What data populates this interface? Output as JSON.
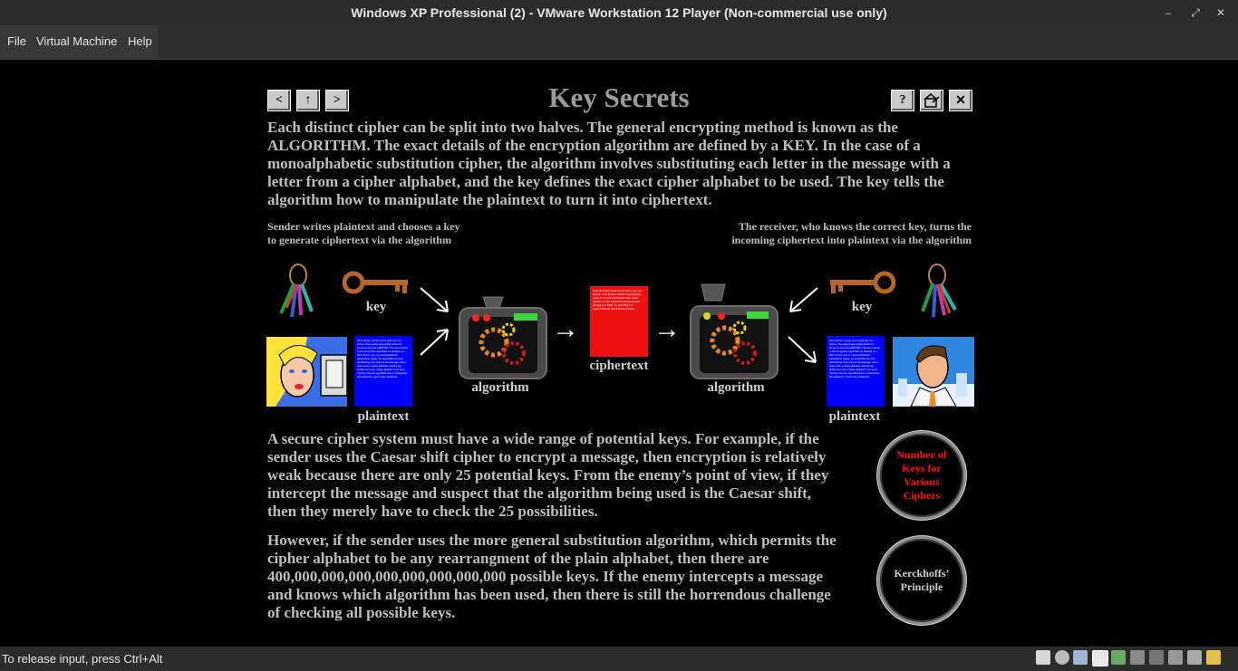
{
  "window": {
    "title": "Windows XP Professional (2) - VMware Workstation 12 Player (Non-commercial use only)",
    "controls": [
      "–",
      "⤢",
      "✕"
    ]
  },
  "menu": [
    "File",
    "Virtual Machine",
    "Help"
  ],
  "status": {
    "message": "To release input, press Ctrl+Alt"
  },
  "page": {
    "title": "Key Secrets",
    "nav": {
      "prev": "<",
      "up": "↑",
      "next": ">",
      "help": "?",
      "close": "✕"
    },
    "intro": "Each distinct cipher can be split into two halves. The general encrypting method is known as the ALGORITHM. The exact details of the encryption algorithm are defined by a KEY. In the case of a monoalphabetic substitution cipher, the algorithm involves substituting each letter in the message with a letter from a cipher alphabet, and the key defines the exact cipher alphabet to be used. The key tells the algorithm how to manipulate the plaintext to turn it into ciphertext.",
    "sender_caption": [
      "Sender writes plaintext and chooses a key",
      "to generate ciphertext via the algorithm"
    ],
    "receiver_caption": [
      "The receiver, who knows the correct key, turns the",
      "incoming ciphertext into plaintext via the algorithm"
    ],
    "diagram": {
      "key_left": "key",
      "key_right": "key",
      "plaintext_left": "plaintext",
      "plaintext_right": "plaintext",
      "algorithm_left": "algorithm",
      "algorithm_right": "algorithm",
      "ciphertext": "ciphertext",
      "arrow_right": "→",
      "plaintext_sample": "Each distinct cipher can be split into two halves. The general encrypting method is known as the ALGORITHM. The exact details of the encryption algorithm are defined by a KEY. In the case of a monoalphabetic substitution cipher, the algorithm involves substituting each letter in the message with a letter from a cipher alphabet, and the key defines the exact cipher alphabet to be used. The key tells the algorithm how to manipulate the plaintext to turn it into ciphertext.",
      "ciphertext_sample": "Eoeh dfvwlqfw flskhu fdq eh vsolw lqwr wzr kdoyhv. Wkh jhqhudo hqfubswlqj phwkrg lv nqrzq dv wkh DOJRULWKP. Wkh hadfw ghwdlov ri wkh hqfubswlrq dojrulwkp duh ghilqhg eb d NHB. Lq wkh fdvh ri d prqrdoskdehwlf vxevwlwxwlrq flskhu."
    },
    "para2": "A secure cipher system must have a wide range of potential keys. For example, if the sender uses the Caesar shift cipher to encrypt a message, then encryption is relatively weak because there are only 25 potential keys. From the enemy’s point of view, if they intercept the message and suspect that the algorithm being used is the Caesar shift, then they merely have to check the 25 possibilities.",
    "para3": "However, if the sender uses the more general substitution algorithm, which permits the cipher alphabet to be any rearrangment of the plain alphabet, then there are 400,000,000,000,000,000,000,000,000 possible keys. If the enemy intercepts a message and knows which algorithm has been used, then there is still the horrendous challenge of checking all possible keys.",
    "button_keys": "Number of Keys for Various Ciphers",
    "button_kerckhoffs": "Kerckhoffs’ Principle"
  },
  "colors": {
    "accent_red": "#ff1010",
    "plaintext_blue": "#0000ff",
    "ciphertext_red": "#ee1111"
  }
}
